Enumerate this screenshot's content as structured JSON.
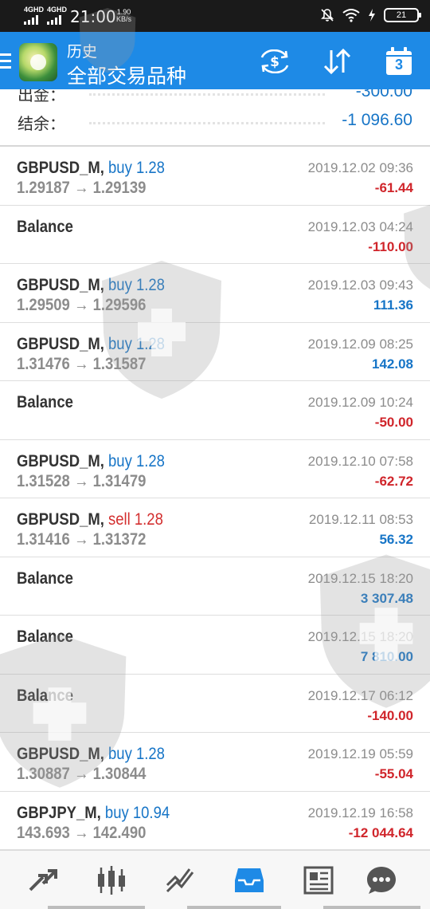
{
  "status_bar": {
    "sim1": "4GHD",
    "sim2": "4GHD",
    "time": "21:00",
    "speed_value": "1.90",
    "speed_unit": "KB/s",
    "battery": "21"
  },
  "header": {
    "subtitle": "历史",
    "title": "全部交易品种",
    "calendar_day": "3"
  },
  "summary": {
    "withdraw_label": "出金：",
    "withdraw_value": "-300.00",
    "balance_label": "结余：",
    "balance_value": "-1 096.60"
  },
  "deals": [
    {
      "symbol": "GBPUSD_M,",
      "side": "buy",
      "volume": "1.28",
      "open": "1.29187",
      "close": "1.29139",
      "time": "2019.12.02 09:36",
      "profit": "-61.44"
    },
    {
      "symbol": "Balance",
      "side": "",
      "volume": "",
      "open": "",
      "close": "",
      "time": "2019.12.03 04:24",
      "profit": "-110.00"
    },
    {
      "symbol": "GBPUSD_M,",
      "side": "buy",
      "volume": "1.28",
      "open": "1.29509",
      "close": "1.29596",
      "time": "2019.12.03 09:43",
      "profit": "111.36"
    },
    {
      "symbol": "GBPUSD_M,",
      "side": "buy",
      "volume": "1.28",
      "open": "1.31476",
      "close": "1.31587",
      "time": "2019.12.09 08:25",
      "profit": "142.08"
    },
    {
      "symbol": "Balance",
      "side": "",
      "volume": "",
      "open": "",
      "close": "",
      "time": "2019.12.09 10:24",
      "profit": "-50.00"
    },
    {
      "symbol": "GBPUSD_M,",
      "side": "buy",
      "volume": "1.28",
      "open": "1.31528",
      "close": "1.31479",
      "time": "2019.12.10 07:58",
      "profit": "-62.72"
    },
    {
      "symbol": "GBPUSD_M,",
      "side": "sell",
      "volume": "1.28",
      "open": "1.31416",
      "close": "1.31372",
      "time": "2019.12.11 08:53",
      "profit": "56.32"
    },
    {
      "symbol": "Balance",
      "side": "",
      "volume": "",
      "open": "",
      "close": "",
      "time": "2019.12.15 18:20",
      "profit": "3 307.48"
    },
    {
      "symbol": "Balance",
      "side": "",
      "volume": "",
      "open": "",
      "close": "",
      "time": "2019.12.15 18:20",
      "profit": "7 810.00"
    },
    {
      "symbol": "Balance",
      "side": "",
      "volume": "",
      "open": "",
      "close": "",
      "time": "2019.12.17 06:12",
      "profit": "-140.00"
    },
    {
      "symbol": "GBPUSD_M,",
      "side": "buy",
      "volume": "1.28",
      "open": "1.30887",
      "close": "1.30844",
      "time": "2019.12.19 05:59",
      "profit": "-55.04"
    },
    {
      "symbol": "GBPJPY_M,",
      "side": "buy",
      "volume": "10.94",
      "open": "143.693",
      "close": "142.490",
      "time": "2019.12.19 16:58",
      "profit": "-12 044.64"
    }
  ],
  "price_arrow": "→",
  "nav": {
    "items": [
      "quotes-icon",
      "chart-icon",
      "trade-icon",
      "history-icon",
      "news-icon",
      "chat-icon"
    ],
    "active": "history-icon"
  },
  "colors": {
    "accent": "#1e8ae6",
    "buy": "#1775c7",
    "sell": "#d32f2f",
    "negative": "#d0252b",
    "positive": "#1775c7"
  }
}
